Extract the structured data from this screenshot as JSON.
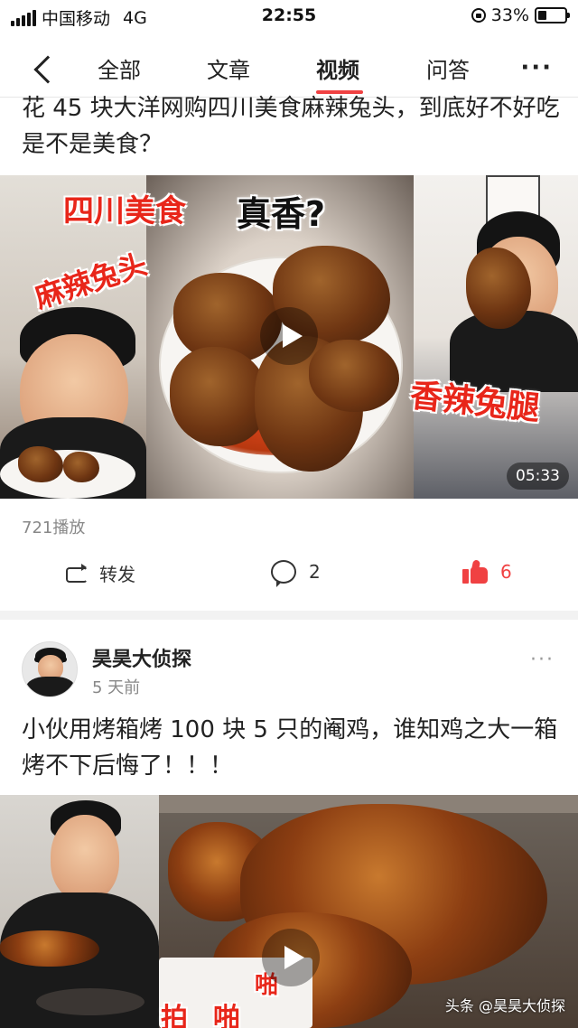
{
  "status_bar": {
    "carrier": "中国移动",
    "network": "4G",
    "time": "22:55",
    "battery_text": "33%",
    "battery_level": 0.33
  },
  "nav": {
    "back_icon": "chevron-left-icon",
    "tabs": [
      {
        "label": "全部",
        "active": false
      },
      {
        "label": "文章",
        "active": false
      },
      {
        "label": "视频",
        "active": true
      },
      {
        "label": "问答",
        "active": false
      }
    ],
    "more_label": "···",
    "accent_color": "#f04142"
  },
  "post1": {
    "title": "花 45 块大洋网购四川美食麻辣兔头，到底好不好吃是不是美食？",
    "thumbnail": {
      "overlay_texts": [
        "四川美食",
        "真香?",
        "麻辣兔头",
        "香辣兔腿"
      ],
      "duration": "05:33"
    },
    "plays": "721播放",
    "actions": {
      "repost_label": "转发",
      "comment_count": "2",
      "like_count": "6"
    }
  },
  "post2": {
    "author": "昊昊大侦探",
    "time": "5 天前",
    "more_label": "···",
    "title": "小伙用烤箱烤 100 块 5 只的阉鸡，谁知鸡之大一箱烤不下后悔了！！！",
    "thumbnail": {
      "overlay_texts": [
        "啪",
        "啪",
        "拍"
      ],
      "watermark": "头条 @昊昊大侦探"
    }
  }
}
